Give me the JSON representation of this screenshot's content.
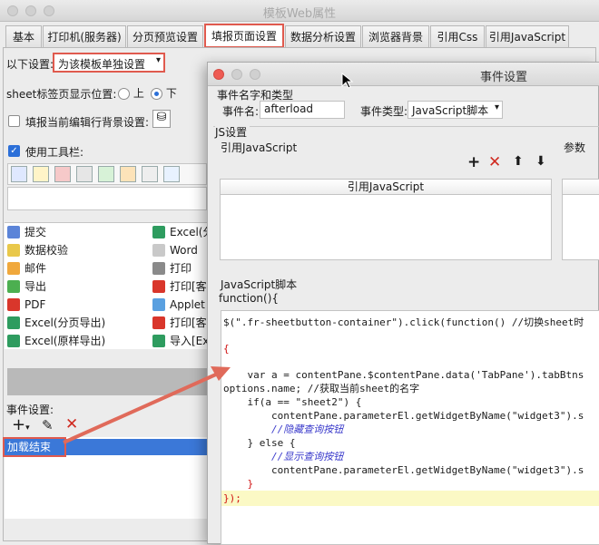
{
  "main_window": {
    "title": "模板Web属性",
    "tabs": [
      "基本",
      "打印机(服务器)",
      "分页预览设置",
      "填报页面设置",
      "数据分析设置",
      "浏览器背景",
      "引用Css",
      "引用JavaScript"
    ],
    "active_tab": "填报页面设置"
  },
  "settings": {
    "following_label": "以下设置:",
    "following_value": "为该模板单独设置",
    "sheet_position_label": "sheet标签页显示位置:",
    "position_top": "上",
    "position_bottom": "下",
    "fill_bg_label": "填报当前编辑行背景设置:",
    "use_toolbar_label": "使用工具栏:"
  },
  "toolbar_buttons": [
    {
      "label": "提交",
      "icon": "save-icon"
    },
    {
      "label": "Excel(分",
      "icon": "excel-icon"
    },
    {
      "label": "数据校验",
      "icon": "check-icon"
    },
    {
      "label": "Word",
      "icon": "word-icon"
    },
    {
      "label": "邮件",
      "icon": "mail-icon"
    },
    {
      "label": "打印",
      "icon": "print-icon"
    },
    {
      "label": "导出",
      "icon": "export-icon"
    },
    {
      "label": "打印[客",
      "icon": "pdf-print-icon"
    },
    {
      "label": "PDF",
      "icon": "pdf-icon"
    },
    {
      "label": "Applet",
      "icon": "applet-icon"
    },
    {
      "label": "Excel(分页导出)",
      "icon": "excel-icon"
    },
    {
      "label": "打印[客",
      "icon": "pdf-print-icon"
    },
    {
      "label": "Excel(原样导出)",
      "icon": "excel-icon"
    },
    {
      "label": "导入[Ex",
      "icon": "import-icon"
    }
  ],
  "events": {
    "label": "事件设置:",
    "items": [
      "加载结束"
    ]
  },
  "dialog": {
    "title": "事件设置",
    "section_event": "事件名字和类型",
    "event_name_label": "事件名:",
    "event_name_value": "afterload",
    "event_type_label": "事件类型:",
    "event_type_value": "JavaScript脚本",
    "js_settings_label": "JS设置",
    "ref_js_label": "引用JavaScript",
    "params_label": "参数",
    "ref_js_column": "引用JavaScript",
    "script_label": "JavaScript脚本",
    "function_header": "function(){"
  },
  "code_lines": [
    "$(\".fr-sheetbutton-container\").click(function() //切换sheet时",
    "{",
    "    var a = contentPane.$contentPane.data('TabPane').tabBtns",
    "options.name; //获取当前sheet的名字",
    "    if(a == \"sheet2\") {",
    "        contentPane.parameterEl.getWidgetByName(\"widget3\").s",
    "        //隐藏查询按钮",
    "    } else {",
    "        //显示查询按钮",
    "        contentPane.parameterEl.getWidgetByName(\"widget3\").s",
    "    }",
    "});"
  ],
  "colors": {
    "highlight_red": "#e05a4e",
    "selection_blue": "#3b78d8",
    "code_highlight": "#fbf9c5"
  }
}
